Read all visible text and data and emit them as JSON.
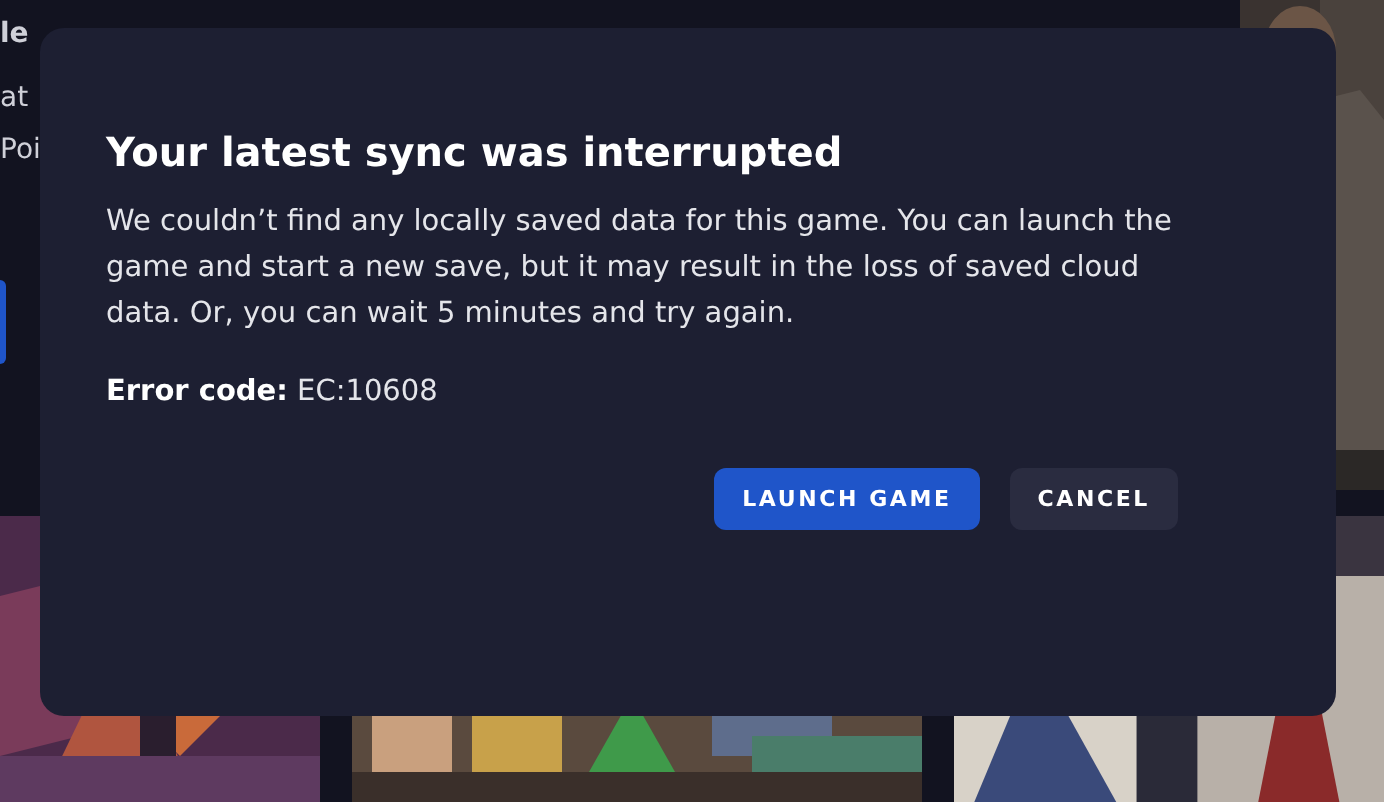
{
  "sidebar": {
    "texts": [
      "le",
      "at",
      "Poi"
    ]
  },
  "dialog": {
    "title": "Your latest sync was interrupted",
    "message": "We couldn’t find any locally saved data for this game. You can launch the game and start a new save, but it may result in the loss of saved cloud data. Or, you can wait 5 minutes and try again.",
    "error": "**Error code:** EC:10608",
    "buttons": [
      {
        "label": "LAUNCH GAME",
        "kind": "primary"
      },
      {
        "label": "CANCEL",
        "kind": "secondary"
      }
    ]
  }
}
